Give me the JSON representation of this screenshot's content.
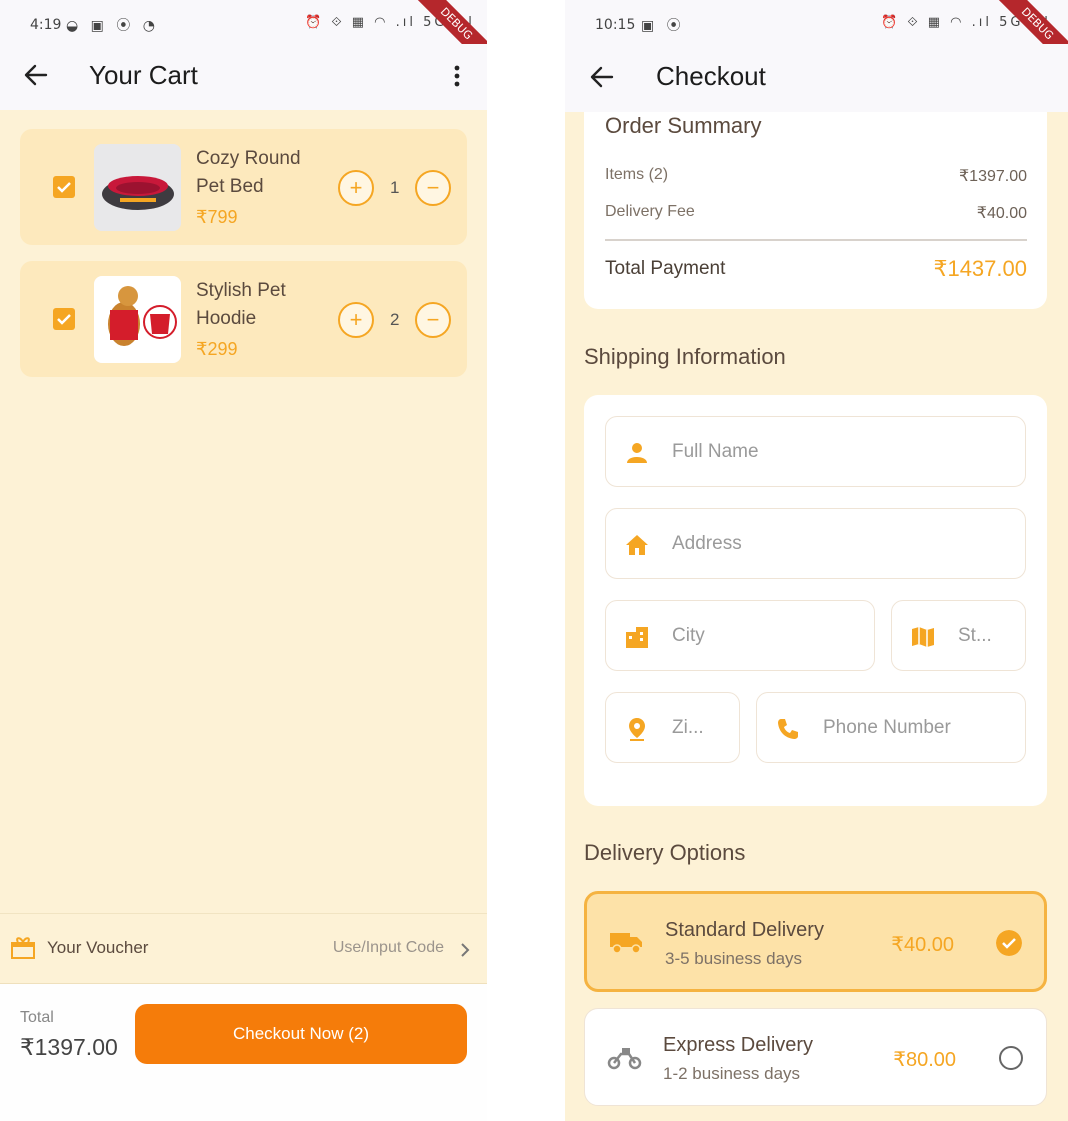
{
  "cart_screen": {
    "status": {
      "time": "4:19",
      "left_icons": "◒ ▣ ⦿ ◔",
      "right_icons": "⏰ ⟐ ▦ ◠ .ıl 5G .ıl",
      "debug": "DEBUG"
    },
    "title": "Your Cart",
    "items": [
      {
        "name": "Cozy Round Pet Bed",
        "price": "₹799",
        "qty": "1",
        "checked": true
      },
      {
        "name": "Stylish Pet Hoodie",
        "price": "₹299",
        "qty": "2",
        "checked": true
      }
    ],
    "voucher": {
      "label": "Your Voucher",
      "action": "Use/Input Code"
    },
    "footer": {
      "total_label": "Total",
      "total_value": "₹1397.00",
      "checkout_label": "Checkout Now (2)"
    }
  },
  "checkout_screen": {
    "status": {
      "time": "10:15",
      "left_icons": "▣ ⦿",
      "right_icons": "⏰ ⟐ ▦ ◠ .ıl 5G .ıl",
      "debug": "DEBUG"
    },
    "title": "Checkout",
    "summary": {
      "title": "Order Summary",
      "items_label": "Items (2)",
      "items_value": "₹1397.00",
      "fee_label": "Delivery Fee",
      "fee_value": "₹40.00",
      "total_label": "Total Payment",
      "total_value": "₹1437.00"
    },
    "shipping": {
      "title": "Shipping Information",
      "full_name": "Full Name",
      "address": "Address",
      "city": "City",
      "state": "St...",
      "zip": "Zi...",
      "phone": "Phone Number"
    },
    "delivery": {
      "title": "Delivery Options",
      "options": [
        {
          "name": "Standard Delivery",
          "days": "3-5 business days",
          "price": "₹40.00",
          "selected": true
        },
        {
          "name": "Express Delivery",
          "days": "1-2 business days",
          "price": "₹80.00",
          "selected": false
        }
      ]
    },
    "colors": {
      "accent": "#f5a623",
      "cta": "#f57c0a",
      "background": "#fdf2d6"
    }
  }
}
